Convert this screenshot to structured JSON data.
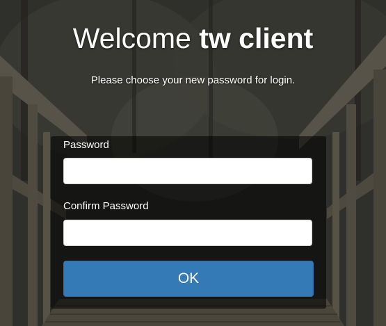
{
  "header": {
    "title_prefix": "Welcome ",
    "title_name": "tw client",
    "subtitle": "Please choose your new password for login."
  },
  "form": {
    "password_label": "Password",
    "password_value": "",
    "confirm_label": "Confirm Password",
    "confirm_value": "",
    "submit_label": "OK"
  },
  "colors": {
    "button_primary": "#337ab7",
    "panel_overlay": "rgba(0,0,0,0.55)",
    "text": "#ffffff"
  }
}
